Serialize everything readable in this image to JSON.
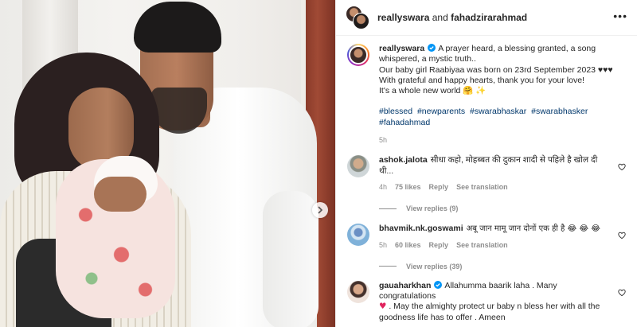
{
  "post": {
    "header_user1": "reallyswara",
    "header_and": " and ",
    "header_user2": "fahadzirarahmad",
    "more_label": "•••"
  },
  "caption": {
    "username": "reallyswara",
    "lines": [
      "A prayer heard, a blessing granted, a song whispered, a mystic truth..",
      "Our baby girl Raabiyaa was born on 23rd September 2023 ♥♥♥",
      "With grateful and happy hearts, thank you for your love!",
      "It's a whole new world 🤗 ✨"
    ],
    "hashtags": [
      "#blessed",
      "#newparents",
      "#swarabhaskar",
      "#swarabhasker",
      "#fahadahmad"
    ],
    "time": "5h"
  },
  "comments": [
    {
      "username": "ashok.jalota",
      "text": "सीधा कहो, मोहब्बत की दुकान शादी से पहिले है खोल दी थी...",
      "time": "4h",
      "likes": "75 likes",
      "reply": "Reply",
      "translate": "See translation",
      "view_replies": "View replies (9)"
    },
    {
      "username": "bhavmik.nk.goswami",
      "text": "अबू जान मामू जान दोनों एक ही है 😂 😂 😂",
      "time": "5h",
      "likes": "60 likes",
      "reply": "Reply",
      "translate": "See translation",
      "view_replies": "View replies (39)"
    },
    {
      "username": "gauaharkhan",
      "text_start": "Allahumma baarik laha . Many congratulations",
      "text_heart": "♥",
      "text_end": ". May the almighty protect ur baby n bless her with all the goodness life has to offer . Ameen"
    }
  ],
  "colors": {
    "link": "#00376b",
    "muted": "#8e8e8e",
    "verified": "#0095f6",
    "heart": "#e0245e"
  },
  "icons": [
    "chevron-right-icon",
    "verified-badge-icon",
    "heart-outline-icon",
    "more-icon"
  ]
}
